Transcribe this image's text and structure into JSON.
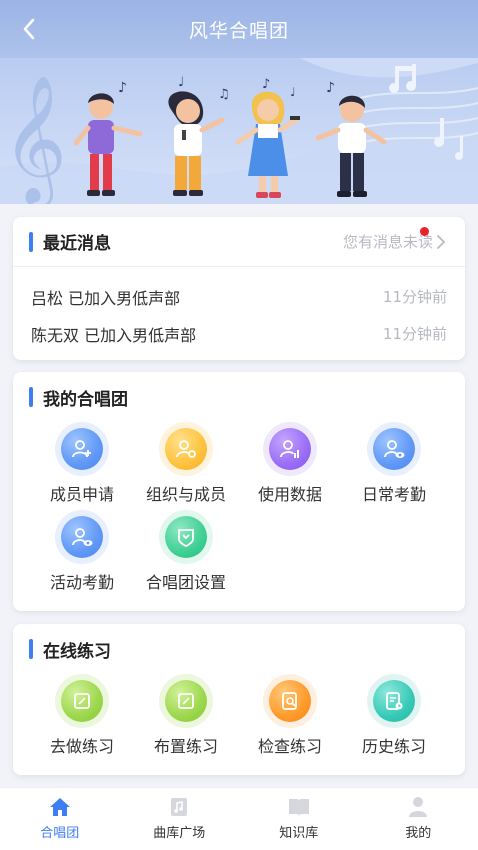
{
  "header": {
    "title": "风华合唱团"
  },
  "messages": {
    "title": "最近消息",
    "unread_text": "您有消息未读",
    "items": [
      {
        "text": "吕松 已加入男低声部",
        "time": "11分钟前"
      },
      {
        "text": "陈无双 已加入男低声部",
        "time": "11分钟前"
      }
    ]
  },
  "choir": {
    "title": "我的合唱团",
    "items": [
      {
        "label": "成员申请",
        "icon": "user-add-icon",
        "color": "#5f98f6"
      },
      {
        "label": "组织与成员",
        "icon": "user-settings-icon",
        "color": "#ffc23d"
      },
      {
        "label": "使用数据",
        "icon": "user-data-icon",
        "color": "#9a6ef6"
      },
      {
        "label": "日常考勤",
        "icon": "user-view-icon",
        "color": "#5f98f6"
      },
      {
        "label": "活动考勤",
        "icon": "user-view-icon",
        "color": "#5f98f6"
      },
      {
        "label": "合唱团设置",
        "icon": "shield-settings-icon",
        "color": "#3fcf94"
      }
    ]
  },
  "practice": {
    "title": "在线练习",
    "items": [
      {
        "label": "去做练习",
        "icon": "edit-icon",
        "color": "#9cd74c"
      },
      {
        "label": "布置练习",
        "icon": "edit-icon",
        "color": "#9cd74c"
      },
      {
        "label": "检查练习",
        "icon": "check-doc-icon",
        "color": "#ff9a2a"
      },
      {
        "label": "历史练习",
        "icon": "history-doc-icon",
        "color": "#37c9b6"
      }
    ]
  },
  "tabs": [
    {
      "label": "合唱团",
      "icon": "home-icon",
      "active": true
    },
    {
      "label": "曲库广场",
      "icon": "music-library-icon",
      "active": false
    },
    {
      "label": "知识库",
      "icon": "book-icon",
      "active": false
    },
    {
      "label": "我的",
      "icon": "profile-icon",
      "active": false
    }
  ],
  "colors": {
    "accent": "#3e7ef3",
    "unread_dot": "#e8232b",
    "header": "#9bb4e6"
  }
}
